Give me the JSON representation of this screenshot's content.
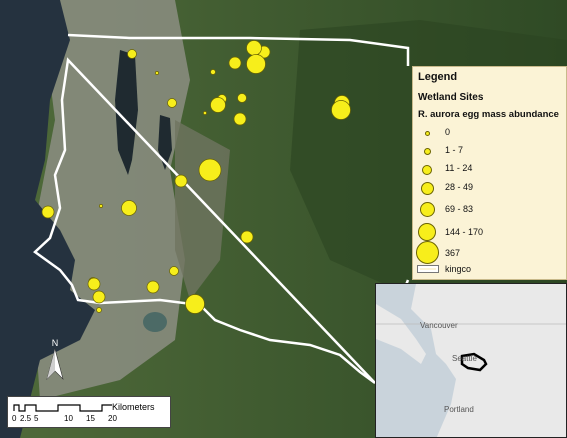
{
  "legend": {
    "title": "Legend",
    "layer": "Wetland Sites",
    "field": "R. aurora egg mass abundance",
    "classes": [
      {
        "label": "0",
        "size_class": 1
      },
      {
        "label": "1 - 7",
        "size_class": 2
      },
      {
        "label": "11 - 24",
        "size_class": 3
      },
      {
        "label": "28 - 49",
        "size_class": 4
      },
      {
        "label": "69 - 83",
        "size_class": 5
      },
      {
        "label": "144 - 170",
        "size_class": 6
      },
      {
        "label": "367",
        "size_class": 7
      }
    ],
    "boundary_label": "kingco"
  },
  "inset": {
    "cities": [
      "Vancouver",
      "Seattle",
      "Portland"
    ]
  },
  "north_arrow": {
    "label": "N"
  },
  "scalebar": {
    "unit": "Kilometers",
    "ticks": [
      "0",
      "2.5",
      "5",
      "10",
      "15",
      "20"
    ]
  },
  "colors": {
    "site_fill": "#f7ee1b",
    "site_stroke": "#6b6400",
    "boundary": "#ffffff",
    "water": "#25323f",
    "forest": "#3d5a2c",
    "urban": "#8a8c80",
    "legend_bg": "#fbf3d6"
  },
  "map": {
    "sites_by_size_class": [
      1,
      1,
      1,
      2,
      2,
      3,
      3,
      3,
      3,
      3,
      3,
      4,
      4,
      4,
      4,
      4,
      4,
      4,
      4,
      4,
      5,
      5,
      5,
      5,
      6,
      6,
      6,
      7
    ]
  }
}
